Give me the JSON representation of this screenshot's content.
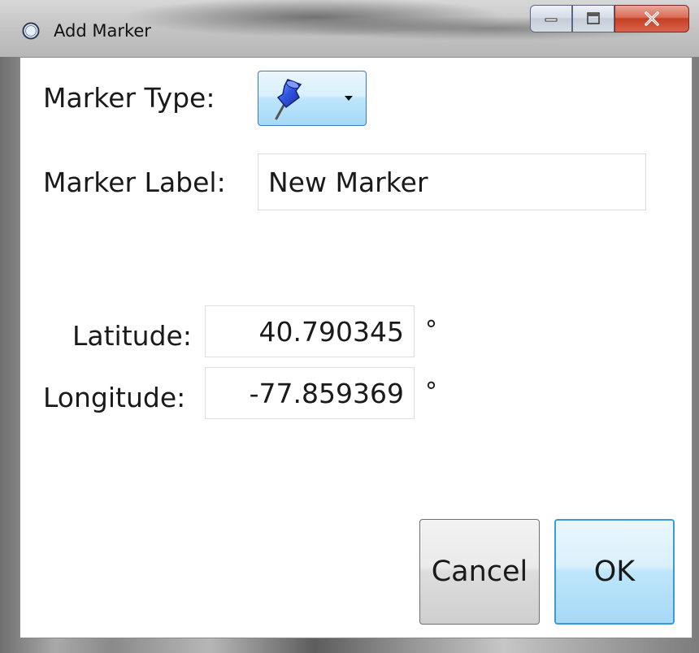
{
  "window": {
    "title": "Add Marker",
    "icon": "circle-app-icon"
  },
  "caption_buttons": {
    "minimize_icon": "minimize-icon",
    "maximize_icon": "maximize-icon",
    "close_icon": "close-icon",
    "close_color": "#c63f25"
  },
  "form": {
    "marker_type_label": "Marker Type:",
    "marker_type_selected_icon": "blue-pushpin-icon",
    "marker_label_label": "Marker Label:",
    "marker_label_value": "New Marker",
    "latitude_label": "Latitude:",
    "latitude_value": "40.790345",
    "latitude_unit": "°",
    "longitude_label": "Longitude:",
    "longitude_value": "-77.859369",
    "longitude_unit": "°"
  },
  "buttons": {
    "cancel": "Cancel",
    "ok": "OK",
    "accent": "#3c9ad8"
  }
}
